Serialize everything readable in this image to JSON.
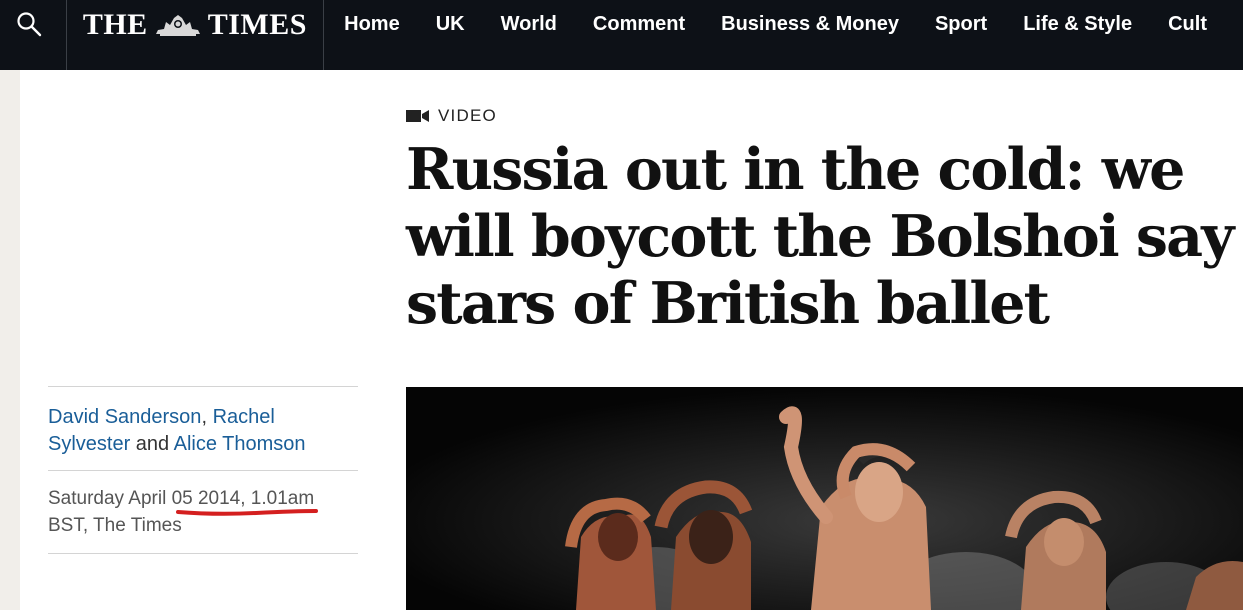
{
  "header": {
    "logo_left": "THE",
    "logo_right": "TIMES",
    "nav": [
      "Home",
      "UK",
      "World",
      "Comment",
      "Business & Money",
      "Sport",
      "Life & Style",
      "Cult"
    ]
  },
  "article": {
    "kicker": "VIDEO",
    "headline": "Russia out in the cold: we will boycott the Bolshoi say stars of British ballet",
    "byline": {
      "author1": "David Sanderson",
      "sep1": ", ",
      "author2": "Rachel Sylvester",
      "sep2": " and ",
      "author3": "Alice Thomson"
    },
    "dateline": "Saturday April 05 2014, 1.01am BST, The Times"
  },
  "colors": {
    "nav_bg": "#0d1117",
    "link": "#1a5e98",
    "annotation_underline": "#d41f1f"
  }
}
